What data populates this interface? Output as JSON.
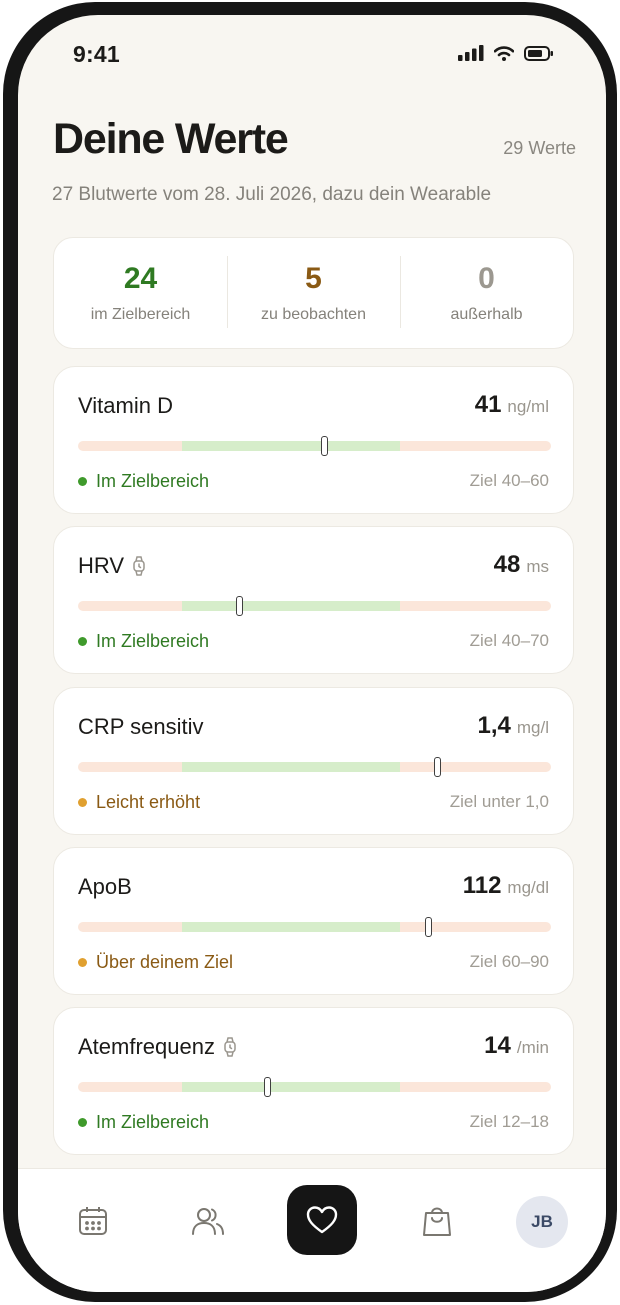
{
  "status_bar": {
    "time": "9:41"
  },
  "header": {
    "title": "Deine Werte",
    "count": "29 Werte",
    "subtitle": "27 Blutwerte vom 28. Juli 2026, dazu dein Wearable"
  },
  "summary": [
    {
      "value": "24",
      "label": "im Zielbereich",
      "color": "#2f7a22"
    },
    {
      "value": "5",
      "label": "zu beobachten",
      "color": "#8a5a14"
    },
    {
      "value": "0",
      "label": "außerhalb",
      "color": "#9c9890"
    }
  ],
  "metrics": [
    {
      "name": "Vitamin D",
      "wearable": false,
      "value": "41",
      "unit": "ng/ml",
      "status": "Im Zielbereich",
      "status_color": "#2f7a22",
      "dot_color": "#3f9a2b",
      "goal": "Ziel 40–60",
      "marker_position": 0.52
    },
    {
      "name": "HRV",
      "wearable": true,
      "value": "48",
      "unit": "ms",
      "status": "Im Zielbereich",
      "status_color": "#2f7a22",
      "dot_color": "#3f9a2b",
      "goal": "Ziel 40–70",
      "marker_position": 0.34
    },
    {
      "name": "CRP sensitiv",
      "wearable": false,
      "value": "1,4",
      "unit": "mg/l",
      "status": "Leicht erhöht",
      "status_color": "#8a5a14",
      "dot_color": "#e0a030",
      "goal": "Ziel unter 1,0",
      "marker_position": 0.76
    },
    {
      "name": "ApoB",
      "wearable": false,
      "value": "112",
      "unit": "mg/dl",
      "status": "Über deinem Ziel",
      "status_color": "#8a5a14",
      "dot_color": "#e0a030",
      "goal": "Ziel 60–90",
      "marker_position": 0.74
    },
    {
      "name": "Atemfrequenz",
      "wearable": true,
      "value": "14",
      "unit": "/min",
      "status": "Im Zielbereich",
      "status_color": "#2f7a22",
      "dot_color": "#3f9a2b",
      "goal": "Ziel 12–18",
      "marker_position": 0.4
    }
  ],
  "bar_scale": {
    "target_start": 0.22,
    "target_end": 0.68
  },
  "nav": {
    "items": [
      "calendar-icon",
      "people-icon",
      "heart-icon",
      "shopping-bag-icon"
    ],
    "active": "heart-icon",
    "avatar_initials": "JB"
  }
}
